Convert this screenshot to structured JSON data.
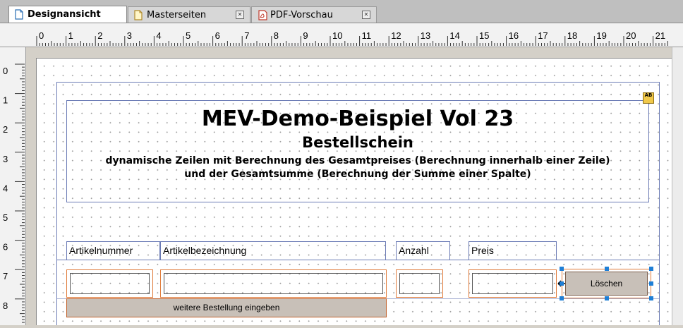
{
  "tabs": [
    {
      "label": "Designansicht"
    },
    {
      "label": "Masterseiten"
    },
    {
      "label": "PDF-Vorschau"
    }
  ],
  "ruler": {
    "h": [
      "0",
      "1",
      "2",
      "3",
      "4",
      "5",
      "6",
      "7",
      "8",
      "9",
      "10",
      "11",
      "12",
      "13",
      "14",
      "15",
      "16",
      "17",
      "18",
      "19",
      "20",
      "21"
    ],
    "v": [
      "0",
      "1",
      "2",
      "3",
      "4",
      "5",
      "6",
      "7",
      "8"
    ]
  },
  "form": {
    "title": "MEV-Demo-Beispiel Vol 23",
    "subtitle": "Bestellschein",
    "desc1": "dynamische Zeilen mit Berechnung des Gesamtpreises (Berechnung innerhalb einer Zeile)",
    "desc2": "und der Gesamtsumme (Berechnung der Summe einer Spalte)",
    "headers": {
      "artikelnummer": "Artikelnummer",
      "artikelbezeichnung": "Artikelbezeichnung",
      "anzahl": "Anzahl",
      "preis": "Preis"
    },
    "delete_button": "Löschen",
    "add_button": "weitere Bestellung eingeben"
  }
}
